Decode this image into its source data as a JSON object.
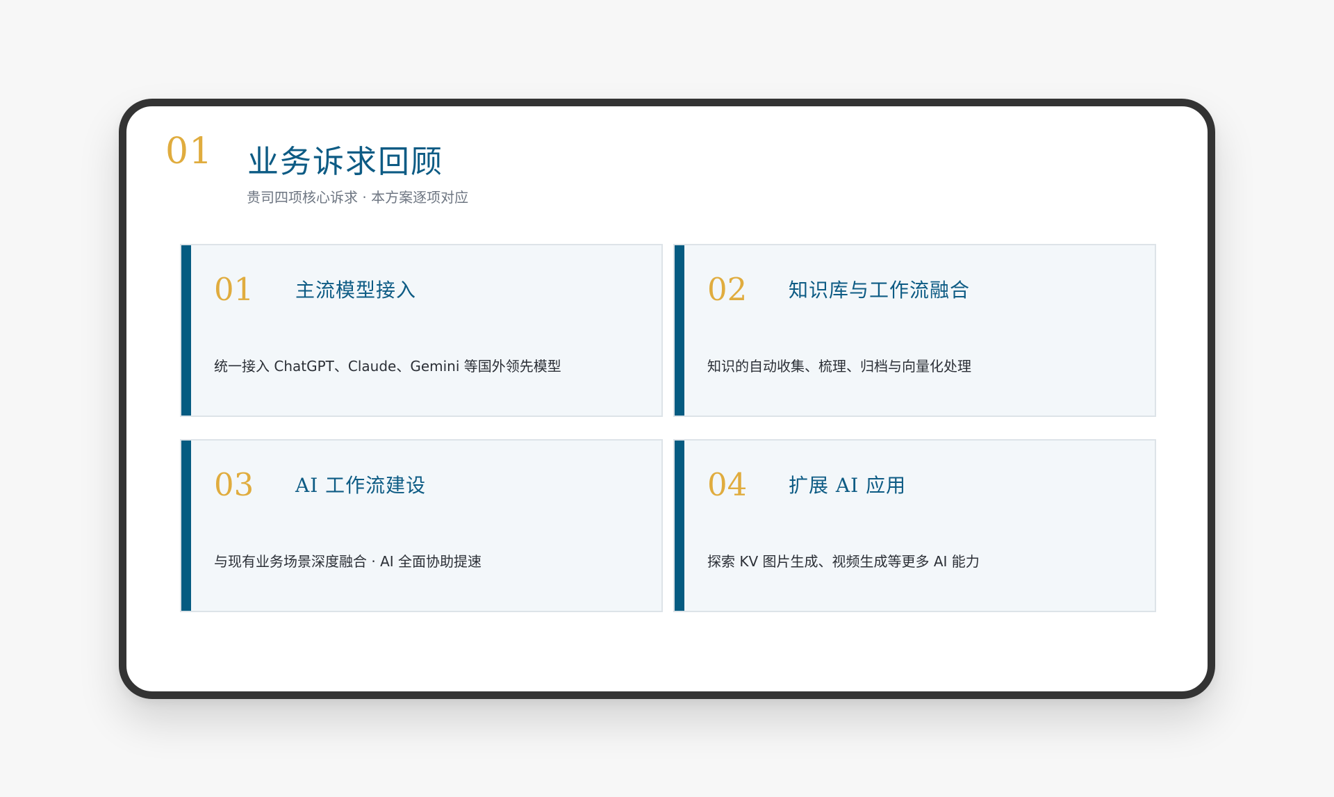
{
  "section": {
    "number": "01",
    "title": "业务诉求回顾",
    "subtitle": "贵司四项核心诉求 · 本方案逐项对应"
  },
  "cards": [
    {
      "number": "01",
      "title": "主流模型接入",
      "description": "统一接入 ChatGPT、Claude、Gemini 等国外领先模型"
    },
    {
      "number": "02",
      "title": "知识库与工作流融合",
      "description": "知识的自动收集、梳理、归档与向量化处理"
    },
    {
      "number": "03",
      "title": "AI 工作流建设",
      "description": "与现有业务场景深度融合 · AI 全面协助提速"
    },
    {
      "number": "04",
      "title": "扩展 AI 应用",
      "description": "探索 KV 图片生成、视频生成等更多 AI 能力"
    }
  ],
  "colors": {
    "accent_gold": "#e0ac3e",
    "brand_blue": "#0d5b84",
    "bar_blue": "#055b81",
    "card_background": "#f3f7fa"
  }
}
